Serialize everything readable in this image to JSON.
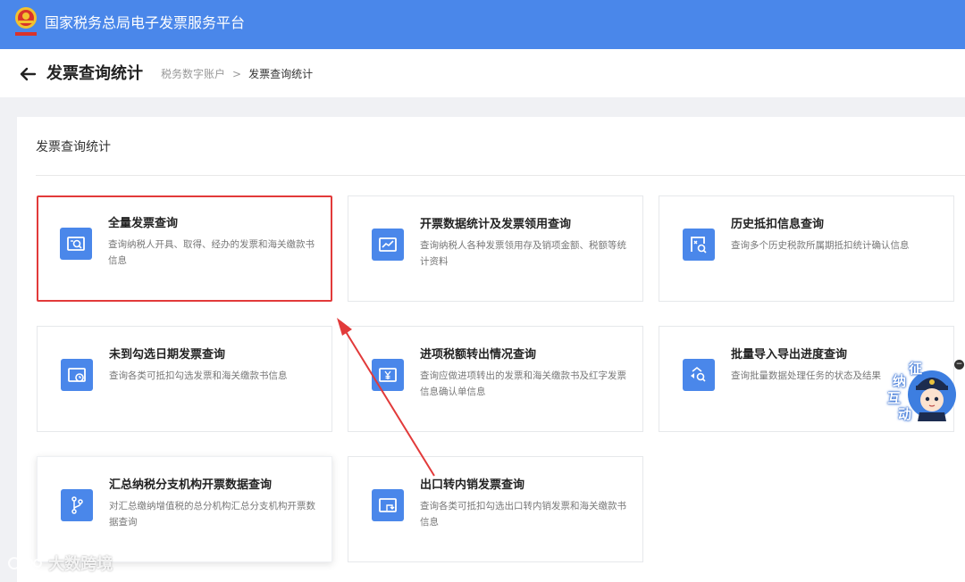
{
  "app": {
    "title": "国家税务总局电子发票服务平台"
  },
  "header": {
    "page_title": "发票查询统计",
    "breadcrumb": [
      "税务数字账户",
      "发票查询统计"
    ],
    "breadcrumb_sep": ">"
  },
  "panel": {
    "title": "发票查询统计"
  },
  "cards": [
    {
      "title": "全量发票查询",
      "desc": "查询纳税人开具、取得、经办的发票和海关缴款书信息",
      "icon": "invoice-search-icon",
      "highlighted": true
    },
    {
      "title": "开票数据统计及发票领用查询",
      "desc": "查询纳税人各种发票领用存及销项金额、税额等统计资料",
      "icon": "trend-chart-icon"
    },
    {
      "title": "历史抵扣信息查询",
      "desc": "查询多个历史税款所属期抵扣统计确认信息",
      "icon": "document-search-icon"
    },
    {
      "title": "未到勾选日期发票查询",
      "desc": "查询各类可抵扣勾选发票和海关缴款书信息",
      "icon": "clock-icon"
    },
    {
      "title": "进项税额转出情况查询",
      "desc": "查询应做进项转出的发票和海关缴款书及红字发票信息确认单信息",
      "icon": "yen-icon"
    },
    {
      "title": "批量导入导出进度查询",
      "desc": "查询批量数据处理任务的状态及结果",
      "icon": "transfer-search-icon"
    },
    {
      "title": "汇总纳税分支机构开票数据查询",
      "desc": "对汇总缴纳增值税的总分机构汇总分支机构开票数据查询",
      "icon": "branch-icon"
    },
    {
      "title": "出口转内销发票查询",
      "desc": "查询各类可抵扣勾选出口转内销发票和海关缴款书信息",
      "icon": "return-arrow-icon"
    }
  ],
  "assistant": {
    "chars": [
      "征",
      "纳",
      "互",
      "动"
    ],
    "close": "−"
  },
  "watermark": "大数跨境",
  "colors": {
    "brand": "#4a87ea",
    "highlight": "#e23a3a"
  }
}
